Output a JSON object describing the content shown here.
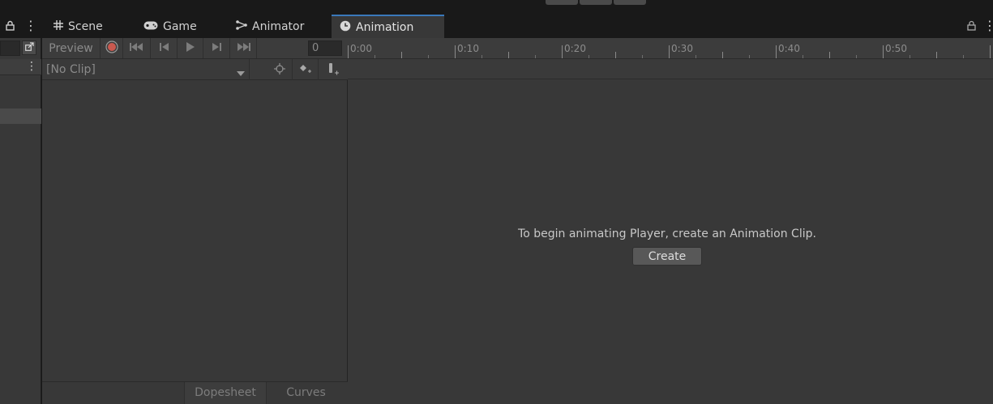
{
  "tabs": [
    {
      "label": "Scene",
      "icon": "grid-icon"
    },
    {
      "label": "Game",
      "icon": "gamepad-icon"
    },
    {
      "label": "Animator",
      "icon": "animator-icon"
    },
    {
      "label": "Animation",
      "icon": "clock-icon",
      "active": true
    }
  ],
  "toolbar": {
    "preview_label": "Preview",
    "frame_value": "0",
    "clip_selector": "[No Clip]"
  },
  "ruler": {
    "ticks": [
      "0:00",
      "0:10",
      "0:20",
      "0:30",
      "0:40",
      "0:50"
    ]
  },
  "empty_state": {
    "message": "To begin animating Player, create an Animation Clip.",
    "create_label": "Create"
  },
  "bottom_tabs": {
    "dopesheet": "Dopesheet",
    "curves": "Curves"
  },
  "colors": {
    "accent": "#3a79bb",
    "record": "#d9534f",
    "panel": "#383838",
    "background": "#191919"
  }
}
